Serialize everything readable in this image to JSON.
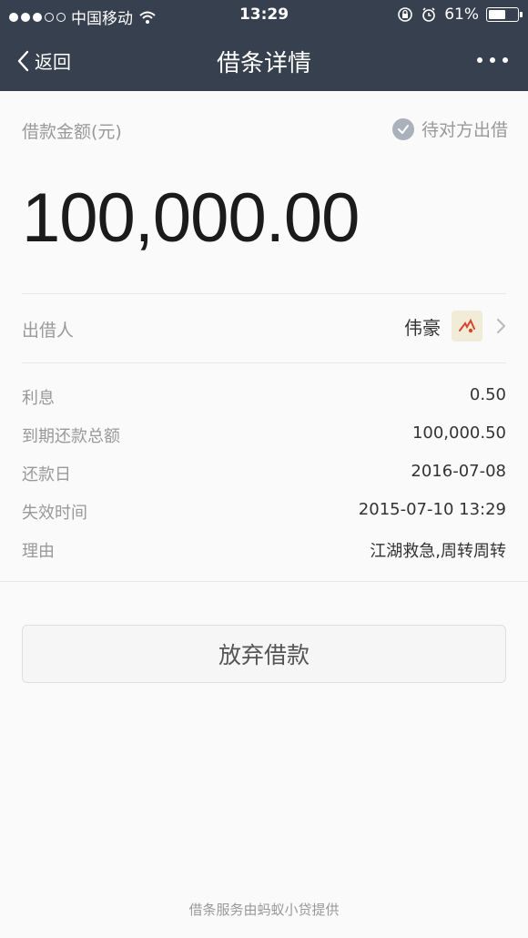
{
  "status_bar": {
    "carrier": "中国移动",
    "time": "13:29",
    "battery": "61%",
    "battery_level": 0.61
  },
  "nav": {
    "back_label": "返回",
    "title": "借条详情",
    "more_icon": "more-icon"
  },
  "amount": {
    "label": "借款金额(元)",
    "status": "待对方出借",
    "value": "100,000.00"
  },
  "lender": {
    "label": "出借人",
    "name": "伟豪"
  },
  "details": [
    {
      "label": "利息",
      "value": "0.50"
    },
    {
      "label": "到期还款总额",
      "value": "100,000.50"
    },
    {
      "label": "还款日",
      "value": "2016-07-08"
    },
    {
      "label": "失效时间",
      "value": "2015-07-10 13:29"
    },
    {
      "label": "理由",
      "value": "江湖救急,周转周转"
    }
  ],
  "actions": {
    "give_up_label": "放弃借款"
  },
  "footer": {
    "text": "借条服务由蚂蚁小贷提供"
  },
  "colors": {
    "header": "#37404e",
    "background": "#fafafa",
    "label": "#999999",
    "amount": "#1b1b1b"
  }
}
